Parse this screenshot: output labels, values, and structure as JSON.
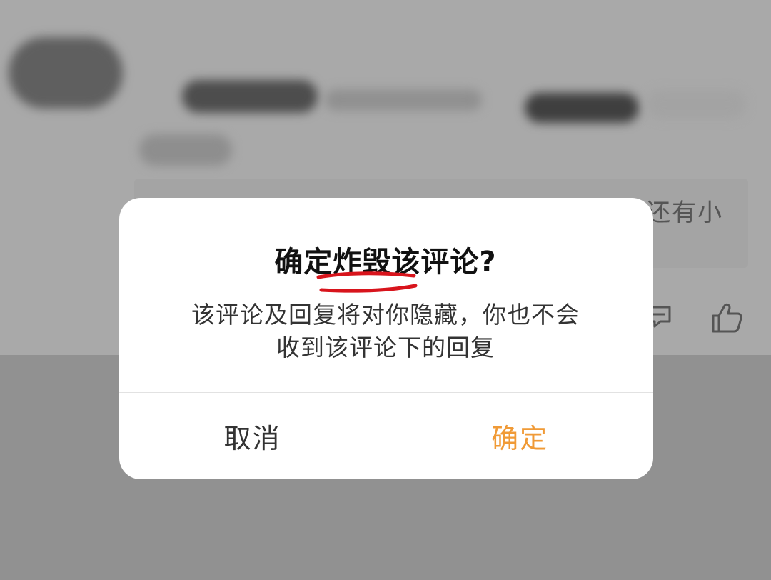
{
  "background": {
    "partial_comment_text": "还有小"
  },
  "dialog": {
    "title": "确定炸毁该评论?",
    "message_line1": "该评论及回复将对你隐藏，你也不会",
    "message_line2": "收到该评论下的回复",
    "cancel_label": "取消",
    "confirm_label": "确定"
  },
  "colors": {
    "confirm_accent": "#f09a36",
    "annotation_underline": "#d8141c",
    "overlay": "#999999"
  },
  "icons": {
    "comment": "comment-icon",
    "like": "thumbs-up-icon"
  }
}
